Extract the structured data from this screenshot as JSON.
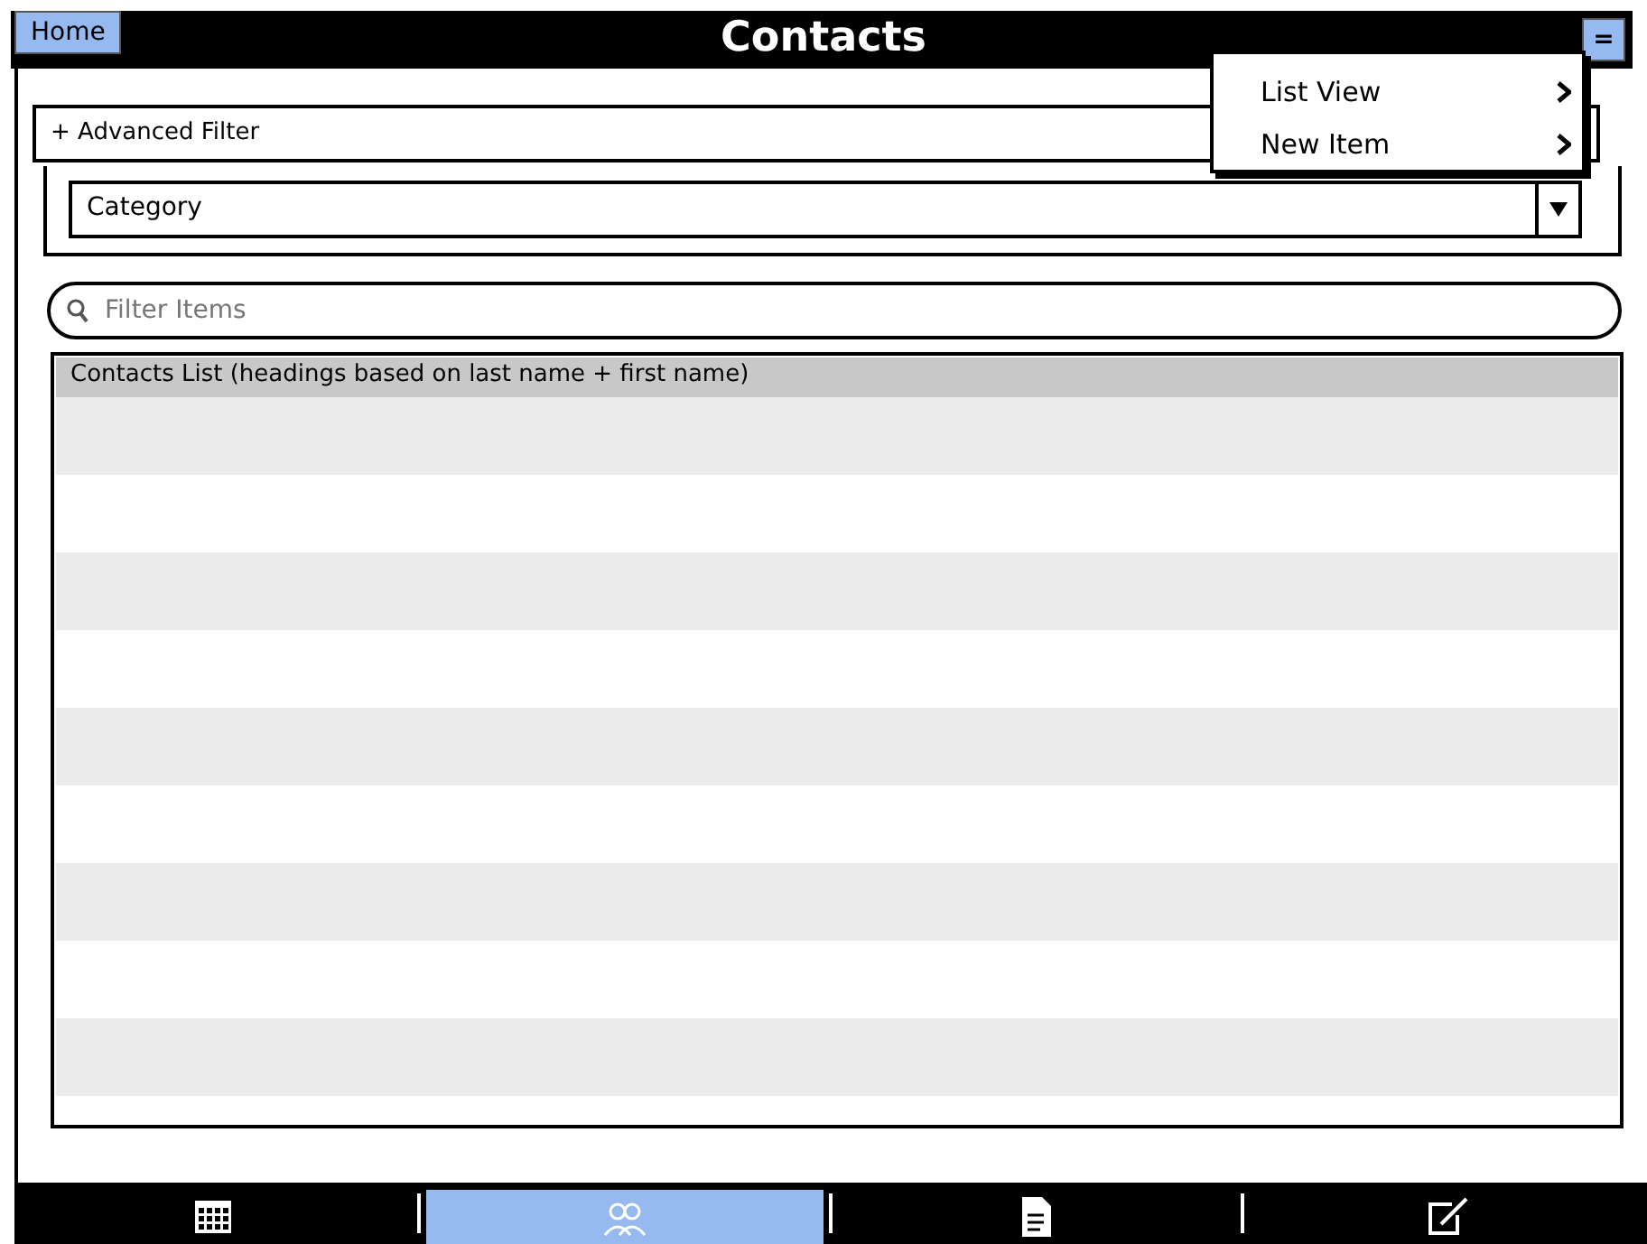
{
  "header": {
    "home_button": "Home",
    "title": "Contacts",
    "menu_button": "="
  },
  "menu": {
    "items": [
      {
        "label": "List View"
      },
      {
        "label": "New Item"
      }
    ]
  },
  "advanced_filter": {
    "label": "+ Advanced Filter"
  },
  "category": {
    "value": "Category"
  },
  "search": {
    "placeholder": "Filter Items"
  },
  "list": {
    "heading": "Contacts List (headings based on last name + first name)"
  },
  "tab_bar": {
    "tabs": [
      {
        "selected": false
      },
      {
        "selected": true
      },
      {
        "selected": false
      },
      {
        "selected": false
      }
    ]
  }
}
